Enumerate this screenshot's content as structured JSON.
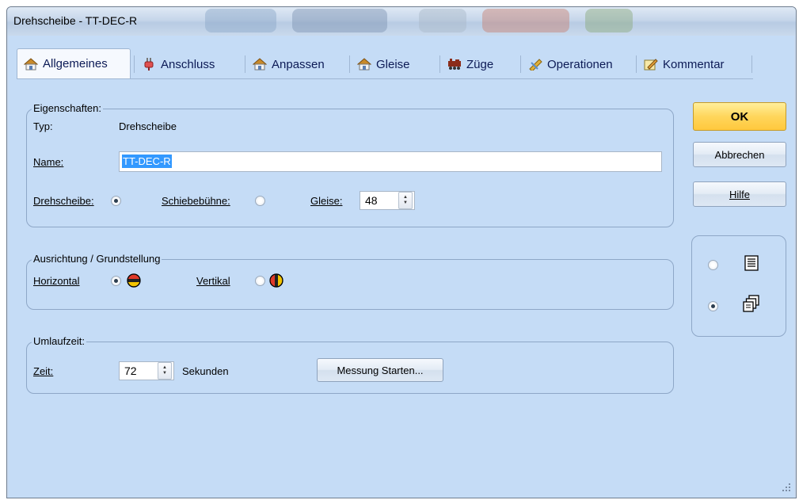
{
  "window": {
    "title": "Drehscheibe - TT-DEC-R"
  },
  "tabs": [
    {
      "label": "Allgemeines",
      "icon": "house-icon",
      "active": true
    },
    {
      "label": "Anschluss",
      "icon": "plug-icon",
      "active": false
    },
    {
      "label": "Anpassen",
      "icon": "house-icon",
      "active": false
    },
    {
      "label": "Gleise",
      "icon": "house-icon",
      "active": false
    },
    {
      "label": "Züge",
      "icon": "train-icon",
      "active": false
    },
    {
      "label": "Operationen",
      "icon": "signal-icon",
      "active": false
    },
    {
      "label": "Kommentar",
      "icon": "note-pencil-icon",
      "active": false
    }
  ],
  "eigenschaften": {
    "legend": "Eigenschaften:",
    "typ_label": "Typ:",
    "typ_value": "Drehscheibe",
    "name_label": "Name:",
    "name_value": "TT-DEC-R",
    "drehscheibe_label": "Drehscheibe:",
    "drehscheibe_checked": true,
    "schiebebuehne_label": "Schiebebühne:",
    "schiebebuehne_checked": false,
    "gleise_label": "Gleise:",
    "gleise_value": "48"
  },
  "ausrichtung": {
    "legend": "Ausrichtung / Grundstellung",
    "horizontal_label": "Horizontal",
    "horizontal_checked": true,
    "vertikal_label": "Vertikal",
    "vertikal_checked": false
  },
  "umlaufzeit": {
    "legend": "Umlaufzeit:",
    "zeit_label": "Zeit:",
    "zeit_value": "72",
    "unit": "Sekunden",
    "messung_button": "Messung Starten..."
  },
  "buttons": {
    "ok": "OK",
    "abbrechen": "Abbrechen",
    "hilfe": "Hilfe"
  },
  "view_options": {
    "list_checked": false,
    "cascade_checked": true
  },
  "colors": {
    "dialog_bg": "#c5dcf6",
    "ok_button": "#ffd65c",
    "selection": "#3399ff"
  }
}
